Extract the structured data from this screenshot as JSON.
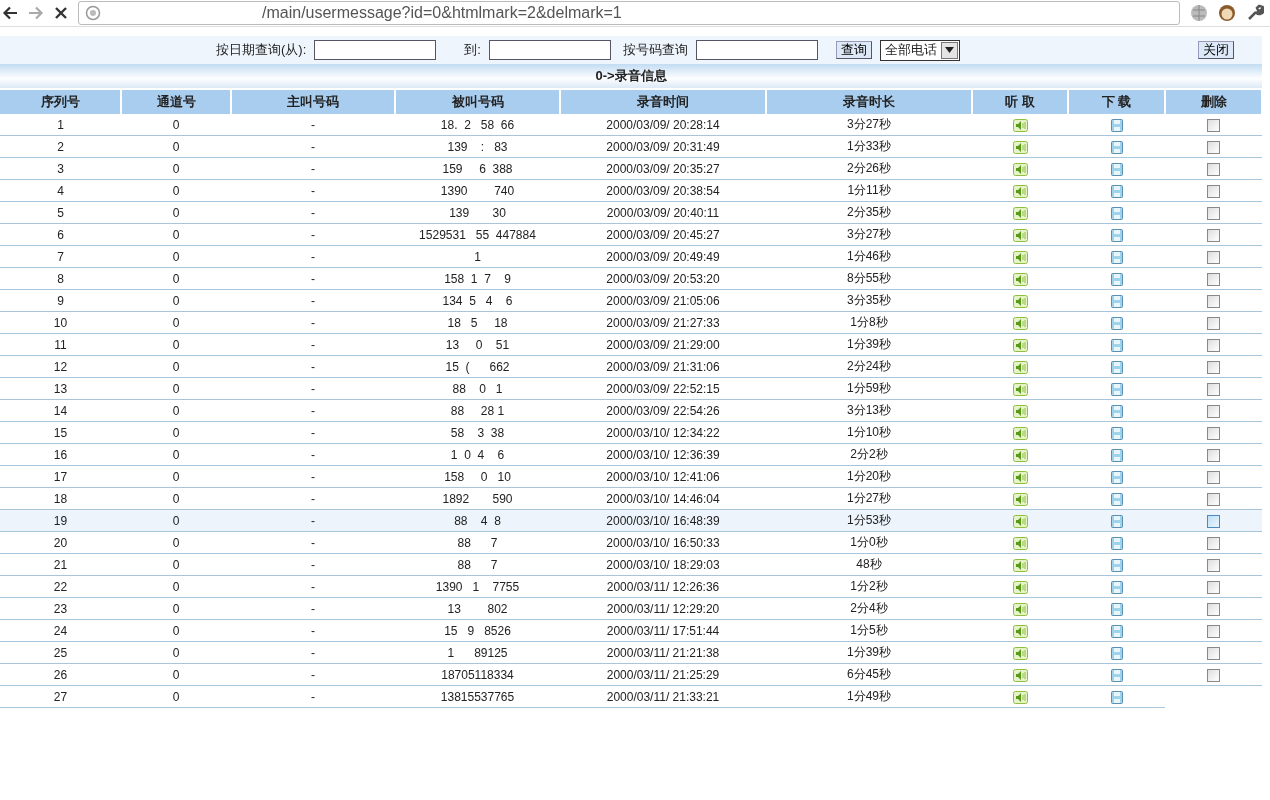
{
  "browser": {
    "url": "/main/usermessage?id=0&htmlmark=2&delmark=1"
  },
  "filter": {
    "date_from_label": "按日期查询(从):",
    "date_to_label": "到:",
    "number_label": "按号码查询",
    "query_button": "查询",
    "type_select": "全部电话",
    "close_button": "关闭"
  },
  "title": "0->录音信息",
  "columns": [
    "序列号",
    "通道号",
    "主叫号码",
    "被叫号码",
    "录音时间",
    "录音时长",
    "听 取",
    "下 载",
    "删除"
  ],
  "rows": [
    {
      "seq": "1",
      "channel": "0",
      "caller": "-",
      "callee": "18.  2   58  66",
      "time": "2000/03/09/ 20:28:14",
      "duration": "3分27秒",
      "highlighted": false,
      "deletable": true
    },
    {
      "seq": "2",
      "channel": "0",
      "caller": "-",
      "callee": "139    :   83",
      "time": "2000/03/09/ 20:31:49",
      "duration": "1分33秒",
      "highlighted": false,
      "deletable": true
    },
    {
      "seq": "3",
      "channel": "0",
      "caller": "-",
      "callee": "159     6  388",
      "time": "2000/03/09/ 20:35:27",
      "duration": "2分26秒",
      "highlighted": false,
      "deletable": true
    },
    {
      "seq": "4",
      "channel": "0",
      "caller": "-",
      "callee": "1390        740",
      "time": "2000/03/09/ 20:38:54",
      "duration": "1分11秒",
      "highlighted": false,
      "deletable": true
    },
    {
      "seq": "5",
      "channel": "0",
      "caller": "-",
      "callee": "139       30",
      "time": "2000/03/09/ 20:40:11",
      "duration": "2分35秒",
      "highlighted": false,
      "deletable": true
    },
    {
      "seq": "6",
      "channel": "0",
      "caller": "-",
      "callee": "1529531   55  447884",
      "time": "2000/03/09/ 20:45:27",
      "duration": "3分27秒",
      "highlighted": false,
      "deletable": true
    },
    {
      "seq": "7",
      "channel": "0",
      "caller": "-",
      "callee": "1",
      "time": "2000/03/09/ 20:49:49",
      "duration": "1分46秒",
      "highlighted": false,
      "deletable": true
    },
    {
      "seq": "8",
      "channel": "0",
      "caller": "-",
      "callee": "158  1  7    9",
      "time": "2000/03/09/ 20:53:20",
      "duration": "8分55秒",
      "highlighted": false,
      "deletable": true
    },
    {
      "seq": "9",
      "channel": "0",
      "caller": "-",
      "callee": "134  5   4    6",
      "time": "2000/03/09/ 21:05:06",
      "duration": "3分35秒",
      "highlighted": false,
      "deletable": true
    },
    {
      "seq": "10",
      "channel": "0",
      "caller": "-",
      "callee": "18   5     18",
      "time": "2000/03/09/ 21:27:33",
      "duration": "1分8秒",
      "highlighted": false,
      "deletable": true
    },
    {
      "seq": "11",
      "channel": "0",
      "caller": "-",
      "callee": "13     0    51",
      "time": "2000/03/09/ 21:29:00",
      "duration": "1分39秒",
      "highlighted": false,
      "deletable": true
    },
    {
      "seq": "12",
      "channel": "0",
      "caller": "-",
      "callee": "15  (      662",
      "time": "2000/03/09/ 21:31:06",
      "duration": "2分24秒",
      "highlighted": false,
      "deletable": true
    },
    {
      "seq": "13",
      "channel": "0",
      "caller": "-",
      "callee": "88    0   1",
      "time": "2000/03/09/ 22:52:15",
      "duration": "1分59秒",
      "highlighted": false,
      "deletable": true
    },
    {
      "seq": "14",
      "channel": "0",
      "caller": "-",
      "callee": "88     28 1",
      "time": "2000/03/09/ 22:54:26",
      "duration": "3分13秒",
      "highlighted": false,
      "deletable": true
    },
    {
      "seq": "15",
      "channel": "0",
      "caller": "-",
      "callee": "58    3  38",
      "time": "2000/03/10/ 12:34:22",
      "duration": "1分10秒",
      "highlighted": false,
      "deletable": true
    },
    {
      "seq": "16",
      "channel": "0",
      "caller": "-",
      "callee": "1  0  4    6",
      "time": "2000/03/10/ 12:36:39",
      "duration": "2分2秒",
      "highlighted": false,
      "deletable": true
    },
    {
      "seq": "17",
      "channel": "0",
      "caller": "-",
      "callee": "158     0   10",
      "time": "2000/03/10/ 12:41:06",
      "duration": "1分20秒",
      "highlighted": false,
      "deletable": true
    },
    {
      "seq": "18",
      "channel": "0",
      "caller": "-",
      "callee": "1892       590",
      "time": "2000/03/10/ 14:46:04",
      "duration": "1分27秒",
      "highlighted": false,
      "deletable": true
    },
    {
      "seq": "19",
      "channel": "0",
      "caller": "-",
      "callee": "88    4  8",
      "time": "2000/03/10/ 16:48:39",
      "duration": "1分53秒",
      "highlighted": true,
      "deletable": true
    },
    {
      "seq": "20",
      "channel": "0",
      "caller": "-",
      "callee": "88      7",
      "time": "2000/03/10/ 16:50:33",
      "duration": "1分0秒",
      "highlighted": false,
      "deletable": true
    },
    {
      "seq": "21",
      "channel": "0",
      "caller": "-",
      "callee": "88      7",
      "time": "2000/03/10/ 18:29:03",
      "duration": "48秒",
      "highlighted": false,
      "deletable": true
    },
    {
      "seq": "22",
      "channel": "0",
      "caller": "-",
      "callee": "1390   1    7755",
      "time": "2000/03/11/ 12:26:36",
      "duration": "1分2秒",
      "highlighted": false,
      "deletable": true
    },
    {
      "seq": "23",
      "channel": "0",
      "caller": "-",
      "callee": "13        802",
      "time": "2000/03/11/ 12:29:20",
      "duration": "2分4秒",
      "highlighted": false,
      "deletable": true
    },
    {
      "seq": "24",
      "channel": "0",
      "caller": "-",
      "callee": "15   9   8526",
      "time": "2000/03/11/ 17:51:44",
      "duration": "1分5秒",
      "highlighted": false,
      "deletable": true
    },
    {
      "seq": "25",
      "channel": "0",
      "caller": "-",
      "callee": "1      89125",
      "time": "2000/03/11/ 21:21:38",
      "duration": "1分39秒",
      "highlighted": false,
      "deletable": true
    },
    {
      "seq": "26",
      "channel": "0",
      "caller": "-",
      "callee": "18705118334",
      "time": "2000/03/11/ 21:25:29",
      "duration": "6分45秒",
      "highlighted": false,
      "deletable": true
    },
    {
      "seq": "27",
      "channel": "0",
      "caller": "-",
      "callee": "13815537765",
      "time": "2000/03/11/ 21:33:21",
      "duration": "1分49秒",
      "highlighted": false,
      "deletable": false
    }
  ]
}
